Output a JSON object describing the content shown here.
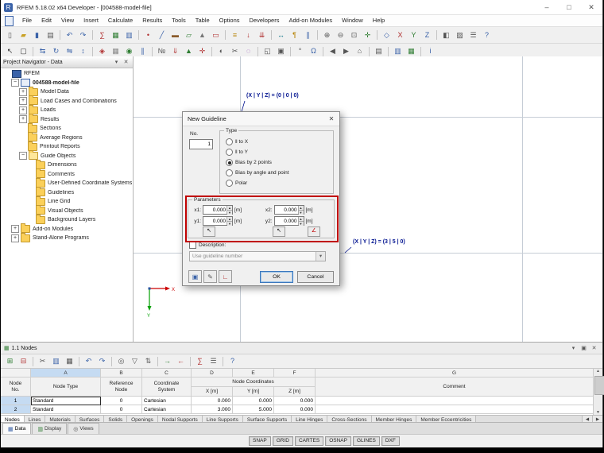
{
  "titlebar": {
    "title": "RFEM 5.18.02 x64 Developer - [004588-model-file]",
    "app_initial": "R",
    "minimize": "–",
    "maximize": "□",
    "close": "✕"
  },
  "menubar": {
    "items": [
      "File",
      "Edit",
      "View",
      "Insert",
      "Calculate",
      "Results",
      "Tools",
      "Table",
      "Options",
      "Developers",
      "Add-on Modules",
      "Window",
      "Help"
    ]
  },
  "toolbars": {
    "row1": [
      {
        "n": "new-file",
        "g": "▯",
        "c": "#555"
      },
      {
        "n": "open-file",
        "g": "▰",
        "c": "#c9a227"
      },
      {
        "n": "save",
        "g": "▮",
        "c": "#3a62a8"
      },
      {
        "n": "print",
        "g": "▤",
        "c": "#555"
      },
      {
        "sep": true
      },
      {
        "n": "undo",
        "g": "↶",
        "c": "#3a62a8"
      },
      {
        "n": "redo",
        "g": "↷",
        "c": "#3a62a8"
      },
      {
        "sep": true
      },
      {
        "n": "calculate",
        "g": "∑",
        "c": "#b03030"
      },
      {
        "n": "results",
        "g": "▦",
        "c": "#2e7d32"
      },
      {
        "n": "tables",
        "g": "▥",
        "c": "#3a62a8"
      },
      {
        "sep": true
      },
      {
        "n": "new-node",
        "g": "•",
        "c": "#b03030"
      },
      {
        "n": "new-line",
        "g": "╱",
        "c": "#3a62a8"
      },
      {
        "n": "new-member",
        "g": "▬",
        "c": "#8a5a2a"
      },
      {
        "n": "new-surface",
        "g": "▱",
        "c": "#2e7d32"
      },
      {
        "n": "new-solid",
        "g": "▲",
        "c": "#777777"
      },
      {
        "n": "new-opening",
        "g": "▭",
        "c": "#b03030"
      },
      {
        "sep": true
      },
      {
        "n": "load-case",
        "g": "≡",
        "c": "#b8860b"
      },
      {
        "n": "nodal-load",
        "g": "↓",
        "c": "#b03030"
      },
      {
        "n": "line-load",
        "g": "⇊",
        "c": "#b03030"
      },
      {
        "sep": true
      },
      {
        "n": "dimension",
        "g": "↔",
        "c": "#0b7285"
      },
      {
        "n": "comment",
        "g": "¶",
        "c": "#b8860b"
      },
      {
        "n": "guideline",
        "g": "∥",
        "c": "#3a62a8"
      },
      {
        "sep": true
      },
      {
        "n": "zoom-in",
        "g": "⊕",
        "c": "#555"
      },
      {
        "n": "zoom-out",
        "g": "⊖",
        "c": "#555"
      },
      {
        "n": "zoom-window",
        "g": "⊡",
        "c": "#555"
      },
      {
        "n": "pan",
        "g": "✛",
        "c": "#2e7d32"
      },
      {
        "sep": true
      },
      {
        "n": "view-isometric",
        "g": "◇",
        "c": "#3a62a8"
      },
      {
        "n": "view-in-x",
        "g": "X",
        "c": "#b03030"
      },
      {
        "n": "view-in-y",
        "g": "Y",
        "c": "#2e7d32"
      },
      {
        "n": "view-in-z",
        "g": "Z",
        "c": "#3a62a8"
      },
      {
        "sep": true
      },
      {
        "n": "display-properties",
        "g": "◧",
        "c": "#555"
      },
      {
        "n": "render-mode",
        "g": "▨",
        "c": "#555"
      },
      {
        "n": "options",
        "g": "☰",
        "c": "#555"
      },
      {
        "n": "help",
        "g": "?",
        "c": "#3a62a8"
      }
    ],
    "row2": [
      {
        "n": "select-arrow",
        "g": "↖",
        "c": "#333"
      },
      {
        "n": "select-window",
        "g": "▢",
        "c": "#333"
      },
      {
        "sep": true
      },
      {
        "n": "move",
        "g": "⇆",
        "c": "#3a62a8"
      },
      {
        "n": "rotate",
        "g": "↻",
        "c": "#3a62a8"
      },
      {
        "n": "mirror",
        "g": "⇋",
        "c": "#3a62a8"
      },
      {
        "n": "scale",
        "g": "↕",
        "c": "#3a62a8"
      },
      {
        "sep": true
      },
      {
        "n": "snap-toggle",
        "g": "◈",
        "c": "#b03030"
      },
      {
        "n": "grid-toggle",
        "g": "▦",
        "c": "#888"
      },
      {
        "n": "object-snap",
        "g": "◉",
        "c": "#2e7d32"
      },
      {
        "n": "guidelines-toggle",
        "g": "∥",
        "c": "#3a62a8"
      },
      {
        "sep": true
      },
      {
        "n": "numbering",
        "g": "№",
        "c": "#555"
      },
      {
        "n": "show-loads",
        "g": "⇓",
        "c": "#b03030"
      },
      {
        "n": "show-supports",
        "g": "▲",
        "c": "#2e7d32"
      },
      {
        "n": "show-axes",
        "g": "✛",
        "c": "#b03030"
      },
      {
        "sep": true
      },
      {
        "n": "visibility",
        "g": "◐",
        "c": "#555"
      },
      {
        "n": "clipping",
        "g": "✂",
        "c": "#555"
      },
      {
        "n": "isolate",
        "g": "◌",
        "c": "#7b1fa2"
      },
      {
        "sep": true
      },
      {
        "n": "new-window",
        "g": "◱",
        "c": "#555"
      },
      {
        "n": "cascade-windows",
        "g": "▣",
        "c": "#555"
      },
      {
        "sep": true
      },
      {
        "n": "units-settings",
        "g": "°",
        "c": "#555"
      },
      {
        "n": "language",
        "g": "Ω",
        "c": "#3a62a8"
      },
      {
        "sep": true
      },
      {
        "n": "previous-view",
        "g": "◀",
        "c": "#555"
      },
      {
        "n": "next-view",
        "g": "▶",
        "c": "#555"
      },
      {
        "n": "full-view",
        "g": "⌂",
        "c": "#555"
      },
      {
        "sep": true
      },
      {
        "n": "print-graphic",
        "g": "▤",
        "c": "#555"
      },
      {
        "sep": true
      },
      {
        "n": "project-navigator-toggle",
        "g": "▥",
        "c": "#3a62a8"
      },
      {
        "n": "table-toggle",
        "g": "▦",
        "c": "#2e7d32"
      },
      {
        "sep": true
      },
      {
        "n": "info",
        "g": "i",
        "c": "#3a62a8"
      }
    ]
  },
  "navigator": {
    "title": "Project Navigator - Data",
    "header_icons": {
      "menu": "▾",
      "close": "✕"
    },
    "items": [
      {
        "label": "RFEM",
        "level": 0,
        "icon": "app"
      },
      {
        "label": "004588-model-file",
        "level": 1,
        "exp": "-",
        "icon": "model",
        "bold": true
      },
      {
        "label": "Model Data",
        "level": 2,
        "exp": "+",
        "icon": "folder"
      },
      {
        "label": "Load Cases and Combinations",
        "level": 2,
        "exp": "+",
        "icon": "folder"
      },
      {
        "label": "Loads",
        "level": 2,
        "exp": "+",
        "icon": "folder"
      },
      {
        "label": "Results",
        "level": 2,
        "exp": "+",
        "icon": "folder"
      },
      {
        "label": "Sections",
        "level": 2,
        "icon": "folder"
      },
      {
        "label": "Average Regions",
        "level": 2,
        "icon": "folder"
      },
      {
        "label": "Printout Reports",
        "level": 2,
        "icon": "folder"
      },
      {
        "label": "Guide Objects",
        "level": 2,
        "exp": "-",
        "icon": "folder-open"
      },
      {
        "label": "Dimensions",
        "level": 3,
        "icon": "folder"
      },
      {
        "label": "Comments",
        "level": 3,
        "icon": "folder"
      },
      {
        "label": "User-Defined Coordinate Systems",
        "level": 3,
        "icon": "folder"
      },
      {
        "label": "Guidelines",
        "level": 3,
        "icon": "folder"
      },
      {
        "label": "Line Grid",
        "level": 3,
        "icon": "folder"
      },
      {
        "label": "Visual Objects",
        "level": 3,
        "icon": "folder"
      },
      {
        "label": "Background Layers",
        "level": 3,
        "icon": "folder"
      },
      {
        "label": "Add-on Modules",
        "level": 1,
        "exp": "+",
        "icon": "folder"
      },
      {
        "label": "Stand-Alone Programs",
        "level": 1,
        "exp": "+",
        "icon": "folder"
      }
    ],
    "tabs": [
      {
        "label": "Data",
        "icon": "▦",
        "c": "#3a62a8",
        "active": true
      },
      {
        "label": "Display",
        "icon": "▥",
        "c": "#2e7d32",
        "active": false
      },
      {
        "label": "Views",
        "icon": "◎",
        "c": "#555555",
        "active": false
      }
    ]
  },
  "canvas": {
    "annotations": [
      {
        "text": "(X | Y | Z) = (0 | 0 | 0)"
      },
      {
        "text": "(X | Y | Z) = (3 | 5 | 0)"
      }
    ],
    "axis_x_label": "X",
    "axis_y_label": "Y"
  },
  "dialog": {
    "title": "New Guideline",
    "close": "✕",
    "no_label": "No.",
    "no_value": "1",
    "type_label": "Type",
    "type_options": [
      "‖ to X",
      "‖ to Y",
      "Bias by 2 points",
      "Bias by angle and point",
      "Polar"
    ],
    "type_selected": 2,
    "parameters_label": "Parameters",
    "params": [
      {
        "label": "x1:",
        "value": "0.000",
        "unit": "[m]"
      },
      {
        "label": "x2:",
        "value": "0.000",
        "unit": "[m]"
      },
      {
        "label": "y1:",
        "value": "0.000",
        "unit": "[m]"
      },
      {
        "label": "y2:",
        "value": "0.000",
        "unit": "[m]"
      }
    ],
    "pick_point_glyph": "↖",
    "pick_line_glyph": "∠",
    "description_label": "Description:",
    "description_value": "Use guideline number",
    "aux_buttons": {
      "details": "▣",
      "comment": "✎",
      "units": "∟"
    },
    "ok_label": "OK",
    "cancel_label": "Cancel",
    "highlight_color": "#c00000"
  },
  "table": {
    "title": "1.1 Nodes",
    "title_icon": "▦",
    "title_icons": {
      "menu": "▾",
      "float": "▣",
      "close": "✕"
    },
    "toolbar": [
      {
        "n": "table-insert-row",
        "g": "⊞",
        "c": "#2e7d32"
      },
      {
        "n": "table-delete-row",
        "g": "⊟",
        "c": "#b03030"
      },
      {
        "sep": true
      },
      {
        "n": "table-cut",
        "g": "✂",
        "c": "#555"
      },
      {
        "n": "table-copy",
        "g": "▥",
        "c": "#3a62a8"
      },
      {
        "n": "table-paste",
        "g": "▦",
        "c": "#555"
      },
      {
        "sep": true
      },
      {
        "n": "table-undo",
        "g": "↶",
        "c": "#3a62a8"
      },
      {
        "n": "table-redo",
        "g": "↷",
        "c": "#3a62a8"
      },
      {
        "sep": true
      },
      {
        "n": "table-find",
        "g": "◎",
        "c": "#555"
      },
      {
        "n": "table-filter",
        "g": "▽",
        "c": "#555"
      },
      {
        "n": "table-sort",
        "g": "⇅",
        "c": "#555"
      },
      {
        "sep": true
      },
      {
        "n": "table-import",
        "g": "→",
        "c": "#2e7d32"
      },
      {
        "n": "table-export",
        "g": "←",
        "c": "#b03030"
      },
      {
        "sep": true
      },
      {
        "n": "table-calculator",
        "g": "∑",
        "c": "#b03030"
      },
      {
        "n": "table-settings",
        "g": "☰",
        "c": "#555"
      },
      {
        "sep": true
      },
      {
        "n": "table-help",
        "g": "?",
        "c": "#3a62a8"
      }
    ],
    "letters": [
      "A",
      "B",
      "C",
      "D",
      "E",
      "F",
      "G"
    ],
    "selected_letter": "A",
    "header": {
      "corner": "Node\nNo.",
      "a": "Node Type",
      "b": "Reference\nNode",
      "c": "Coordinate\nSystem",
      "coords": "Node Coordinates",
      "d": "X [m]",
      "e": "Y [m]",
      "f": "Z [m]",
      "g": "Comment"
    },
    "rows": [
      {
        "no": "1",
        "cells": [
          "Standard",
          "0",
          "Cartesian",
          "0.000",
          "0.000",
          "0.000",
          ""
        ]
      },
      {
        "no": "2",
        "cells": [
          "Standard",
          "0",
          "Cartesian",
          "3.000",
          "5.000",
          "0.000",
          ""
        ]
      }
    ],
    "sheet_tabs": [
      "Nodes",
      "Lines",
      "Materials",
      "Surfaces",
      "Solids",
      "Openings",
      "Nodal Supports",
      "Line Supports",
      "Surface Supports",
      "Line Hinges",
      "Cross-Sections",
      "Member Hinges",
      "Member Eccentricities"
    ],
    "tab_nav": {
      "left": "◀",
      "right": "▶"
    }
  },
  "statusbar": {
    "toggles": [
      "SNAP",
      "GRID",
      "CARTES",
      "OSNAP",
      "GLINES",
      "DXF"
    ]
  }
}
